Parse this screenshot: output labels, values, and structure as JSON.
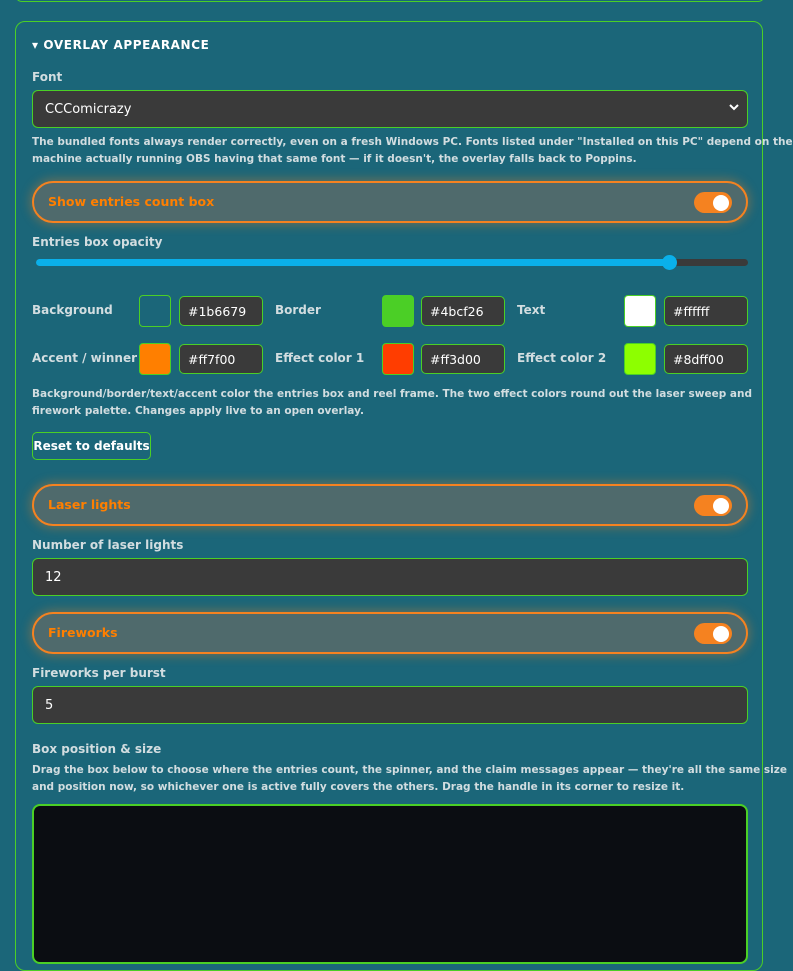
{
  "section": {
    "title": "▾ OVERLAY APPEARANCE"
  },
  "font": {
    "label": "Font",
    "value": "CCComicrazy",
    "help_line1": "The bundled fonts always render correctly, even on a fresh Windows PC. Fonts listed under \"Installed on this PC\" depend on the",
    "help_line2": "machine actually running OBS having that same font — if it doesn't, the overlay falls back to Poppins."
  },
  "entries_box": {
    "toggle_label": "Show entries count box",
    "enabled": true,
    "opacity_label": "Entries box opacity",
    "opacity": 0.89
  },
  "colors": [
    {
      "label": "Background",
      "value": "#1b6679"
    },
    {
      "label": "Border",
      "value": "#4bcf26"
    },
    {
      "label": "Text",
      "value": "#ffffff"
    },
    {
      "label": "Accent / winner",
      "value": "#ff7f00"
    },
    {
      "label": "Effect color 1",
      "value": "#ff3d00"
    },
    {
      "label": "Effect color 2",
      "value": "#8dff00"
    }
  ],
  "colors_help_line1": "Background/border/text/accent color the entries box and reel frame. The two effect colors round out the laser sweep and",
  "colors_help_line2": "firework palette. Changes apply live to an open overlay.",
  "reset_label": "Reset to defaults",
  "lasers": {
    "toggle_label": "Laser lights",
    "enabled": true,
    "count_label": "Number of laser lights",
    "count": "12"
  },
  "fireworks": {
    "toggle_label": "Fireworks",
    "enabled": true,
    "count_label": "Fireworks per burst",
    "count": "5"
  },
  "box": {
    "label": "Box position & size",
    "help_line1": "Drag the box below to choose where the entries count, the spinner, and the claim messages appear — they're all the same size",
    "help_line2": "and position now, so whichever one is active fully covers the others. Drag the handle in its corner to resize it."
  },
  "accent": "#f58220",
  "border_color": "#4bcf26",
  "background": "#1b6679"
}
